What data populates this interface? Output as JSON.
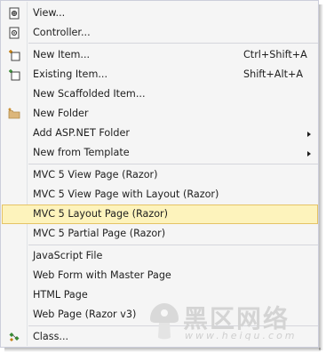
{
  "menu": {
    "items": [
      {
        "label": "View...",
        "icon": "view-icon"
      },
      {
        "label": "Controller...",
        "icon": "controller-icon"
      },
      {
        "label": "New Item...",
        "shortcut": "Ctrl+Shift+A",
        "icon": "new-item-icon"
      },
      {
        "label": "Existing Item...",
        "shortcut": "Shift+Alt+A",
        "icon": "existing-item-icon"
      },
      {
        "label": "New Scaffolded Item..."
      },
      {
        "label": "New Folder",
        "icon": "folder-icon"
      },
      {
        "label": "Add ASP.NET Folder",
        "submenu": true
      },
      {
        "label": "New from Template",
        "submenu": true
      },
      {
        "label": "MVC 5 View Page (Razor)"
      },
      {
        "label": "MVC 5 View Page with Layout (Razor)"
      },
      {
        "label": "MVC 5 Layout Page (Razor)",
        "highlighted": true
      },
      {
        "label": "MVC 5 Partial Page (Razor)"
      },
      {
        "label": "JavaScript File"
      },
      {
        "label": "Web Form with Master Page"
      },
      {
        "label": "HTML Page"
      },
      {
        "label": "Web Page (Razor v3)"
      },
      {
        "label": "Class...",
        "icon": "class-icon"
      }
    ]
  },
  "watermark": {
    "text": "黑区网络",
    "url": "www.heiqu.com"
  },
  "colors": {
    "menu_bg": "#f5f5f5",
    "highlight_bg": "#fdf3bc",
    "highlight_border": "#e5c365",
    "separator": "#d5d6dc",
    "text": "#1e1e1e"
  }
}
